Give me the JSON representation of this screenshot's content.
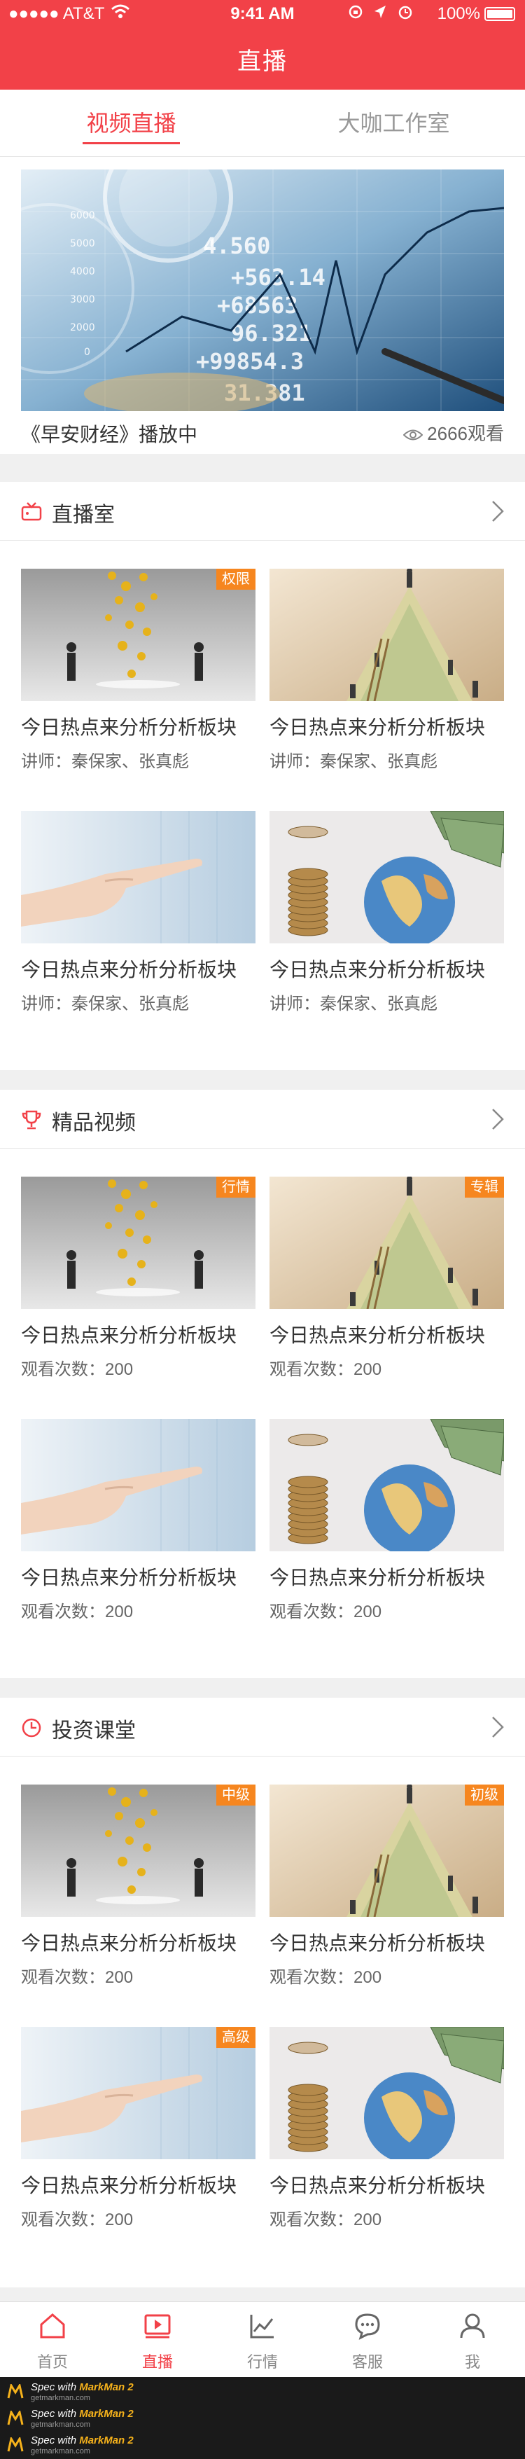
{
  "status_bar": {
    "carrier": "●●●●● AT&T",
    "time": "9:41 AM",
    "battery": "100%"
  },
  "header": {
    "title": "直播"
  },
  "tabs": [
    {
      "label": "视频直播",
      "active": true
    },
    {
      "label": "大咖工作室",
      "active": false
    }
  ],
  "banner": {
    "caption": "《早安财经》播放中",
    "views": "2666观看"
  },
  "live_room": {
    "title": "直播室",
    "items": [
      {
        "badge": "权限",
        "title": "今日热点来分析分析板块",
        "subtitle": "讲师：秦保家、张真彪",
        "image": "coins-men"
      },
      {
        "badge": "",
        "title": "今日热点来分析分析板块",
        "subtitle": "讲师：秦保家、张真彪",
        "image": "money-pyramid"
      },
      {
        "badge": "",
        "title": "今日热点来分析分析板块",
        "subtitle": "讲师：秦保家、张真彪",
        "image": "pointing-hand"
      },
      {
        "badge": "",
        "title": "今日热点来分析分析板块",
        "subtitle": "讲师：秦保家、张真彪",
        "image": "globe-dollars"
      }
    ]
  },
  "featured_videos": {
    "title": "精品视频",
    "items": [
      {
        "badge": "行情",
        "title": "今日热点来分析分析板块",
        "subtitle": "观看次数：200",
        "image": "coins-men"
      },
      {
        "badge": "专辑",
        "title": "今日热点来分析分析板块",
        "subtitle": "观看次数：200",
        "image": "money-pyramid"
      },
      {
        "badge": "",
        "title": "今日热点来分析分析板块",
        "subtitle": "观看次数：200",
        "image": "pointing-hand"
      },
      {
        "badge": "",
        "title": "今日热点来分析分析板块",
        "subtitle": "观看次数：200",
        "image": "globe-dollars"
      }
    ]
  },
  "investment_class": {
    "title": "投资课堂",
    "items": [
      {
        "badge": "中级",
        "title": "今日热点来分析分析板块",
        "subtitle": "观看次数：200",
        "image": "coins-men"
      },
      {
        "badge": "初级",
        "title": "今日热点来分析分析板块",
        "subtitle": "观看次数：200",
        "image": "money-pyramid"
      },
      {
        "badge": "高级",
        "title": "今日热点来分析分析板块",
        "subtitle": "观看次数：200",
        "image": "pointing-hand"
      },
      {
        "badge": "",
        "title": "今日热点来分析分析板块",
        "subtitle": "观看次数：200",
        "image": "globe-dollars"
      }
    ]
  },
  "bottom_nav": [
    {
      "label": "首页",
      "icon": "home-icon",
      "active": false
    },
    {
      "label": "直播",
      "icon": "play-icon",
      "active": true
    },
    {
      "label": "行情",
      "icon": "chart-line-icon",
      "active": false
    },
    {
      "label": "客服",
      "icon": "chat-icon",
      "active": false
    },
    {
      "label": "我",
      "icon": "user-icon",
      "active": false
    }
  ],
  "watermark": {
    "text_prefix": "Spec with ",
    "brand": "MarkMan 2",
    "url": "getmarkman.com"
  },
  "colors": {
    "brand": "#f24148",
    "badge": "#f6861f",
    "background": "#f0f0f0",
    "text_primary": "#333333",
    "text_secondary": "#666666"
  }
}
